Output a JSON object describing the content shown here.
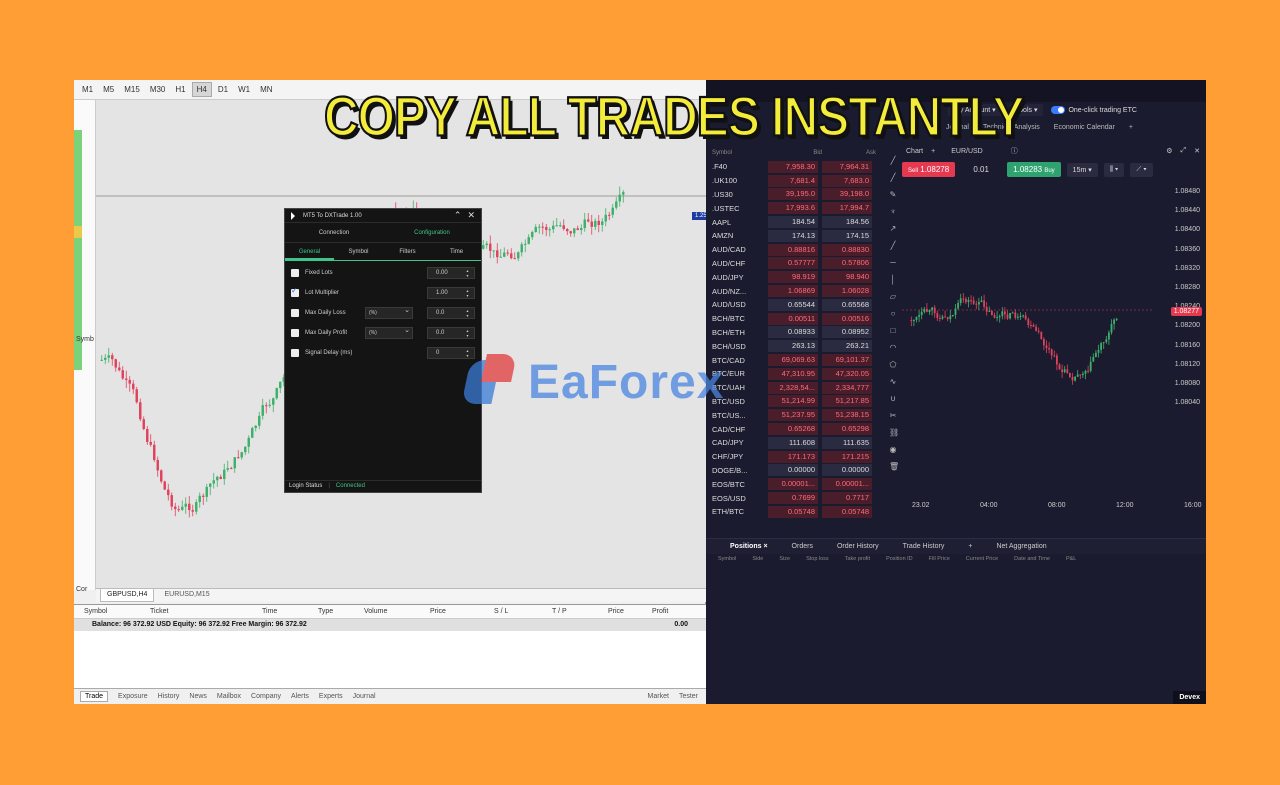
{
  "headline": "COPY ALL TRADES INSTANTLY",
  "watermark": "EaForex",
  "mt5": {
    "timeframes": [
      "M1",
      "M5",
      "M15",
      "M30",
      "H1",
      "H4",
      "D1",
      "W1",
      "MN"
    ],
    "active_timeframe": "H4",
    "side_labels": [
      "Symb",
      "Cor"
    ],
    "price_tag": "1.25400",
    "symbol_tabs": [
      "GBPUSD,H4",
      "EURUSD,M15"
    ],
    "trade_columns": [
      "Symbol",
      "Ticket",
      "Time",
      "Type",
      "Volume",
      "Price",
      "S / L",
      "T / P",
      "Price",
      "Profit"
    ],
    "balance_text": "Balance: 96 372.92 USD  Equity: 96 372.92  Free Margin: 96 372.92",
    "balance_value": "0.00",
    "bottom_tabs": [
      "Trade",
      "Exposure",
      "History",
      "News",
      "Mailbox",
      "Company",
      "Alerts",
      "Experts",
      "Journal"
    ],
    "bottom_right": [
      "Market",
      "Tester"
    ]
  },
  "dialog": {
    "title": "MT5 To DXTrade 1.00",
    "tabs_top": [
      "Connection",
      "Configuration"
    ],
    "tabs_sub": [
      "General",
      "Symbol",
      "Filters",
      "Time"
    ],
    "rows": [
      {
        "label": "Fixed Lots",
        "checked": false,
        "select": "",
        "value": "0.00"
      },
      {
        "label": "Lot Multiplier",
        "checked": true,
        "select": "",
        "value": "1.00"
      },
      {
        "label": "Max Daily Loss",
        "checked": false,
        "select": "(%)",
        "value": "0.0"
      },
      {
        "label": "Max Daily Profit",
        "checked": false,
        "select": "(%)",
        "value": "0.0"
      },
      {
        "label": "Signal Delay (ms)",
        "checked": false,
        "select": "",
        "value": "0"
      }
    ],
    "status_label": "Login Status",
    "status_value": "Connected"
  },
  "dx": {
    "menu": [
      "My Account",
      "Tools"
    ],
    "oneclick": "One-click trading ETC",
    "menu2": [
      "Journal",
      "Technical Analysis",
      "Economic Calendar",
      "+"
    ],
    "watch_headers": [
      "Symbol",
      "Bid",
      "Ask"
    ],
    "watchlist": [
      {
        "s": ".F40",
        "b": "7,958.30",
        "a": "7,964.31",
        "t": "dn"
      },
      {
        "s": ".UK100",
        "b": "7,681.4",
        "a": "7,683.0",
        "t": "dn"
      },
      {
        "s": ".US30",
        "b": "39,195.0",
        "a": "39,198.0",
        "t": "dn"
      },
      {
        "s": ".USTEC",
        "b": "17,993.6",
        "a": "17,994.7",
        "t": "dn"
      },
      {
        "s": "AAPL",
        "b": "184.54",
        "a": "184.56",
        "t": "nu"
      },
      {
        "s": "AMZN",
        "b": "174.13",
        "a": "174.15",
        "t": "nu"
      },
      {
        "s": "AUD/CAD",
        "b": "0.88816",
        "a": "0.88830",
        "t": "dn"
      },
      {
        "s": "AUD/CHF",
        "b": "0.57777",
        "a": "0.57806",
        "t": "dn"
      },
      {
        "s": "AUD/JPY",
        "b": "98.919",
        "a": "98.940",
        "t": "dn"
      },
      {
        "s": "AUD/NZ...",
        "b": "1.06869",
        "a": "1.06028",
        "t": "dn"
      },
      {
        "s": "AUD/USD",
        "b": "0.65544",
        "a": "0.65568",
        "t": "nu"
      },
      {
        "s": "BCH/BTC",
        "b": "0.00511",
        "a": "0.00516",
        "t": "dn"
      },
      {
        "s": "BCH/ETH",
        "b": "0.08933",
        "a": "0.08952",
        "t": "nu"
      },
      {
        "s": "BCH/USD",
        "b": "263.13",
        "a": "263.21",
        "t": "nu"
      },
      {
        "s": "BTC/CAD",
        "b": "69,069.63",
        "a": "69,101.37",
        "t": "dn"
      },
      {
        "s": "BTC/EUR",
        "b": "47,310.95",
        "a": "47,320.05",
        "t": "dn"
      },
      {
        "s": "BTC/UAH",
        "b": "2,328,54...",
        "a": "2,334,777",
        "t": "dn"
      },
      {
        "s": "BTC/USD",
        "b": "51,214.99",
        "a": "51,217.85",
        "t": "dn"
      },
      {
        "s": "BTC/US...",
        "b": "51,237.95",
        "a": "51,238.15",
        "t": "dn"
      },
      {
        "s": "CAD/CHF",
        "b": "0.65268",
        "a": "0.65298",
        "t": "dn"
      },
      {
        "s": "CAD/JPY",
        "b": "111.608",
        "a": "111.635",
        "t": "nu"
      },
      {
        "s": "CHF/JPY",
        "b": "171.173",
        "a": "171.215",
        "t": "dn"
      },
      {
        "s": "DOGE/B...",
        "b": "0.00000",
        "a": "0.00000",
        "t": "nu"
      },
      {
        "s": "EOS/BTC",
        "b": "0.00001...",
        "a": "0.00001...",
        "t": "dn"
      },
      {
        "s": "EOS/USD",
        "b": "0.7699",
        "a": "0.7717",
        "t": "dn"
      },
      {
        "s": "ETH/BTC",
        "b": "0.05748",
        "a": "0.05748",
        "t": "dn"
      }
    ],
    "chart_tab": "Chart",
    "chart_symbol": "EUR/USD",
    "sell_price": "1.08278",
    "lot": "0.01",
    "buy_price": "1.08283",
    "buy_label": "Buy",
    "sell_label": "Sell",
    "timeframe": "15m",
    "y_labels": [
      "1.08480",
      "1.08440",
      "1.08400",
      "1.08360",
      "1.08320",
      "1.08280",
      "1.08240",
      "1.08200",
      "1.08160",
      "1.08120",
      "1.08080",
      "1.08040"
    ],
    "current_price": "1.08277",
    "x_labels": [
      "23.02",
      "04:00",
      "08:00",
      "12:00",
      "16:00"
    ],
    "pos_tabs": [
      "Positions ×",
      "Orders",
      "Order History",
      "Trade History",
      "+",
      "Net Aggregation"
    ],
    "pos_headers": [
      "Symbol",
      "Side",
      "Size",
      "Stop loss",
      "Take profit",
      "Position ID",
      "Fill Price",
      "Current Price",
      "Date and Time",
      "P&L"
    ],
    "corner": "Devex"
  },
  "colors": {
    "background": "#ff9e35",
    "headline": "#f4ec3a",
    "up_candle": "#3fb06b",
    "down_candle": "#e0425c"
  }
}
